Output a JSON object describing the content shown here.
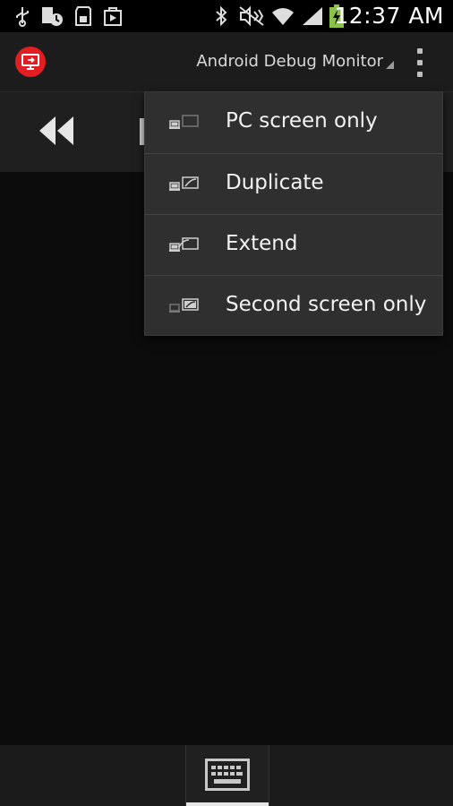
{
  "status_bar": {
    "time": "12:37 AM",
    "icons": [
      "usb-icon",
      "screenshot-icon",
      "sd-card-icon",
      "play-store-icon",
      "bluetooth-icon",
      "mute-icon",
      "wifi-icon",
      "signal-icon",
      "battery-charging-icon"
    ]
  },
  "action_bar": {
    "app_icon": "screen-share-icon",
    "title": "Android Debug Monitor",
    "overflow_icon": "overflow-menu-icon"
  },
  "media_controls": {
    "rewind_icon": "rewind-icon"
  },
  "menu": {
    "items": [
      {
        "label": "PC screen only",
        "icon": "pc-screen-only-icon"
      },
      {
        "label": "Duplicate",
        "icon": "duplicate-icon"
      },
      {
        "label": "Extend",
        "icon": "extend-icon"
      },
      {
        "label": "Second screen only",
        "icon": "second-screen-only-icon"
      }
    ]
  },
  "bottom_bar": {
    "keyboard_icon": "keyboard-icon"
  },
  "colors": {
    "accent": "#e21e23",
    "menu_bg": "#2f2f2f",
    "content_bg": "#0c0c0c"
  }
}
